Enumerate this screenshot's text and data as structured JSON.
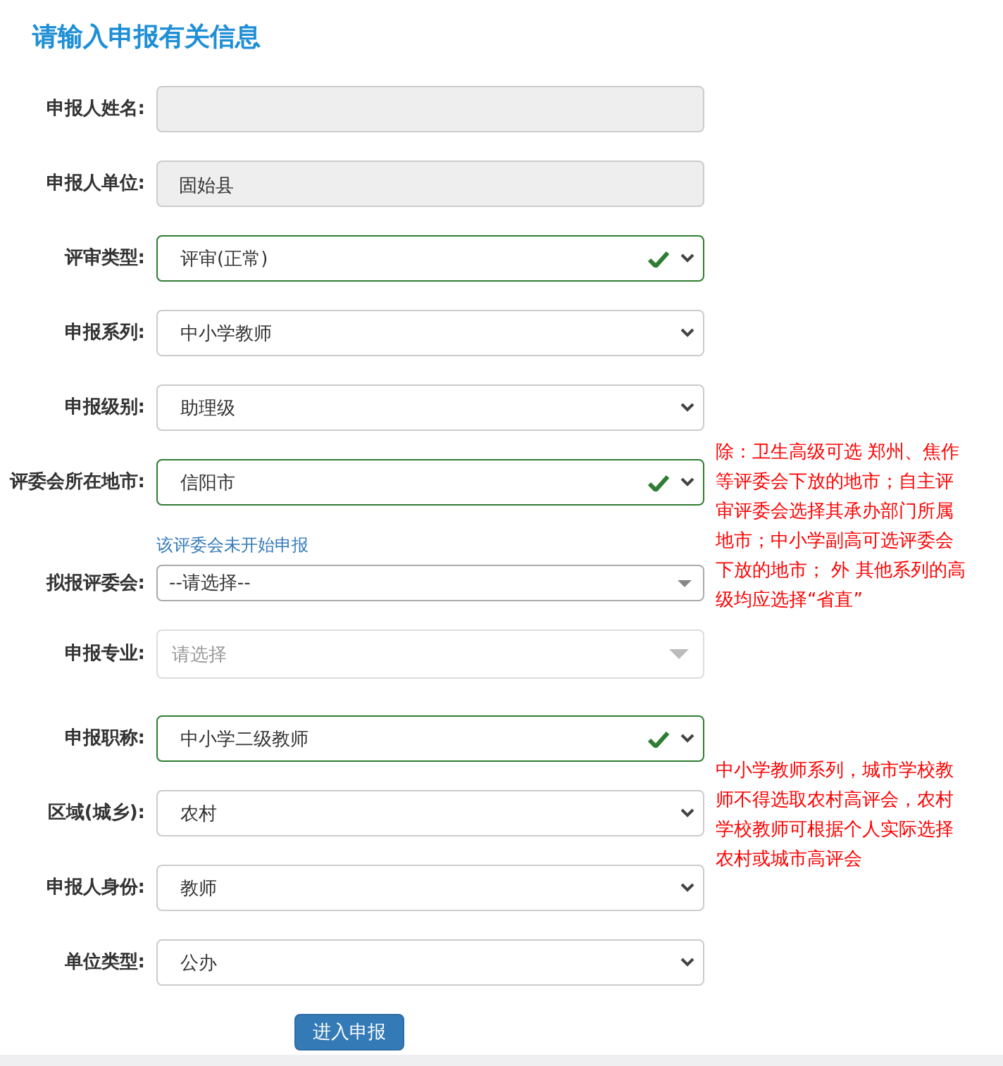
{
  "title": "请输入申报有关信息",
  "fields": [
    {
      "label": "申报人姓名:",
      "kind": "readonly"
    },
    {
      "label": "申报人单位:",
      "kind": "readonly",
      "value": "固始县"
    },
    {
      "label": "评审类型:",
      "kind": "select",
      "value": "评审(正常)",
      "valid": true
    },
    {
      "label": "申报系列:",
      "kind": "select",
      "value": "中小学教师",
      "valid": false
    },
    {
      "label": "申报级别:",
      "kind": "select",
      "value": "助理级",
      "valid": false
    },
    {
      "label": "评委会所在地市:",
      "kind": "select",
      "value": "信阳市",
      "valid": true
    },
    {
      "label": "拟报评委会:",
      "kind": "select2",
      "value": "--请选择--",
      "hint": "该评委会未开始申报",
      "disabled": false
    },
    {
      "label": "申报专业:",
      "kind": "select2",
      "placeholder": "请选择",
      "disabled": true
    },
    {
      "label": "申报职称:",
      "kind": "select",
      "value": "中小学二级教师",
      "valid": true
    },
    {
      "label": "区域(城乡):",
      "kind": "select",
      "value": "农村",
      "valid": false
    },
    {
      "label": "申报人身份:",
      "kind": "select",
      "value": "教师",
      "valid": false
    },
    {
      "label": "单位类型:",
      "kind": "select",
      "value": "公办",
      "valid": false
    }
  ],
  "notes": [
    "除：卫生高级可选 郑州、焦作等评委会下放的地市；自主评审评委会选择其承办部门所属地市；中小学副高可选评委会下放的地市； 外 其他系列的高级均应选择“省直”",
    "中小学教师系列，城市学校教师不得选取农村高评会，农村学校教师可根据个人实际选择农村或城市高评会"
  ],
  "submit_button": "进入申报"
}
